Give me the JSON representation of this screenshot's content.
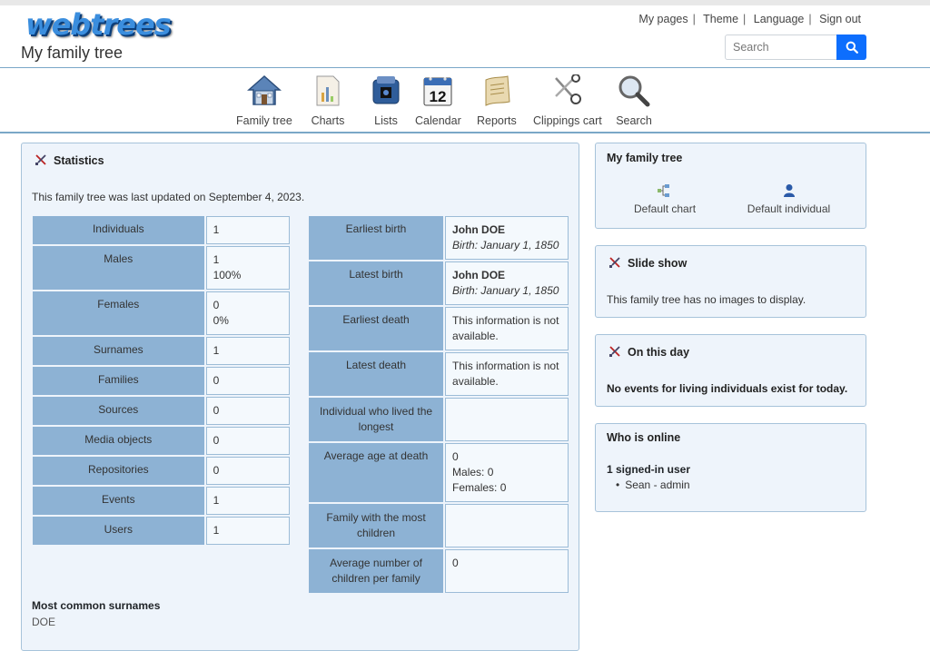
{
  "header": {
    "logo": "webtrees",
    "site_title": "My family tree",
    "links": [
      "My pages",
      "Theme",
      "Language",
      "Sign out"
    ],
    "search_placeholder": "Search"
  },
  "nav": [
    {
      "label": "Family tree",
      "icon": "house-icon"
    },
    {
      "label": "Charts",
      "icon": "chart-icon"
    },
    {
      "label": "Lists",
      "icon": "list-icon"
    },
    {
      "label": "Calendar",
      "icon": "calendar-icon"
    },
    {
      "label": "Reports",
      "icon": "scroll-icon"
    },
    {
      "label": "Clippings cart",
      "icon": "scissors-icon"
    },
    {
      "label": "Search",
      "icon": "magnifier-icon"
    }
  ],
  "calendar_day": "12",
  "statistics": {
    "title": "Statistics",
    "updated": "This family tree was last updated on September 4, 2023.",
    "left_rows": [
      {
        "label": "Individuals",
        "line1": "1",
        "line2": ""
      },
      {
        "label": "Males",
        "line1": "1",
        "line2": "100%"
      },
      {
        "label": "Females",
        "line1": "0",
        "line2": "0%"
      },
      {
        "label": "Surnames",
        "line1": "1",
        "line2": ""
      },
      {
        "label": "Families",
        "line1": "0",
        "line2": ""
      },
      {
        "label": "Sources",
        "line1": "0",
        "line2": ""
      },
      {
        "label": "Media objects",
        "line1": "0",
        "line2": ""
      },
      {
        "label": "Repositories",
        "line1": "0",
        "line2": ""
      },
      {
        "label": "Events",
        "line1": "1",
        "line2": ""
      },
      {
        "label": "Users",
        "line1": "1",
        "line2": ""
      }
    ],
    "right_rows": {
      "earliest_birth": {
        "label": "Earliest birth",
        "name": "John DOE",
        "birth_label": "Birth:",
        "birth_date": "January 1, 1850"
      },
      "latest_birth": {
        "label": "Latest birth",
        "name": "John DOE",
        "birth_label": "Birth:",
        "birth_date": "January 1, 1850"
      },
      "earliest_death": {
        "label": "Earliest death",
        "value1": "This information is not",
        "value2": "available."
      },
      "latest_death": {
        "label": "Latest death",
        "value1": "This information is not",
        "value2": "available."
      },
      "lived_longest": {
        "label1": "Individual who lived the",
        "label2": "longest",
        "value": ""
      },
      "avg_age": {
        "label": "Average age at death",
        "v1": "0",
        "v2": "Males: 0",
        "v3": "Females: 0"
      },
      "most_children": {
        "label1": "Family with the most",
        "label2": "children",
        "value": ""
      },
      "avg_children": {
        "label1": "Average number of",
        "label2": "children per family",
        "value": "0"
      }
    },
    "surnames_title": "Most common surnames",
    "surnames": "DOE"
  },
  "sidebar": {
    "family_tree": {
      "title": "My family tree",
      "default_chart": "Default chart",
      "default_individual": "Default individual"
    },
    "slideshow": {
      "title": "Slide show",
      "text": "This family tree has no images to display."
    },
    "on_this_day": {
      "title": "On this day",
      "text": "No events for living individuals exist for today."
    },
    "who_online": {
      "title": "Who is online",
      "count": "1 signed-in user",
      "user": "Sean - admin"
    }
  }
}
